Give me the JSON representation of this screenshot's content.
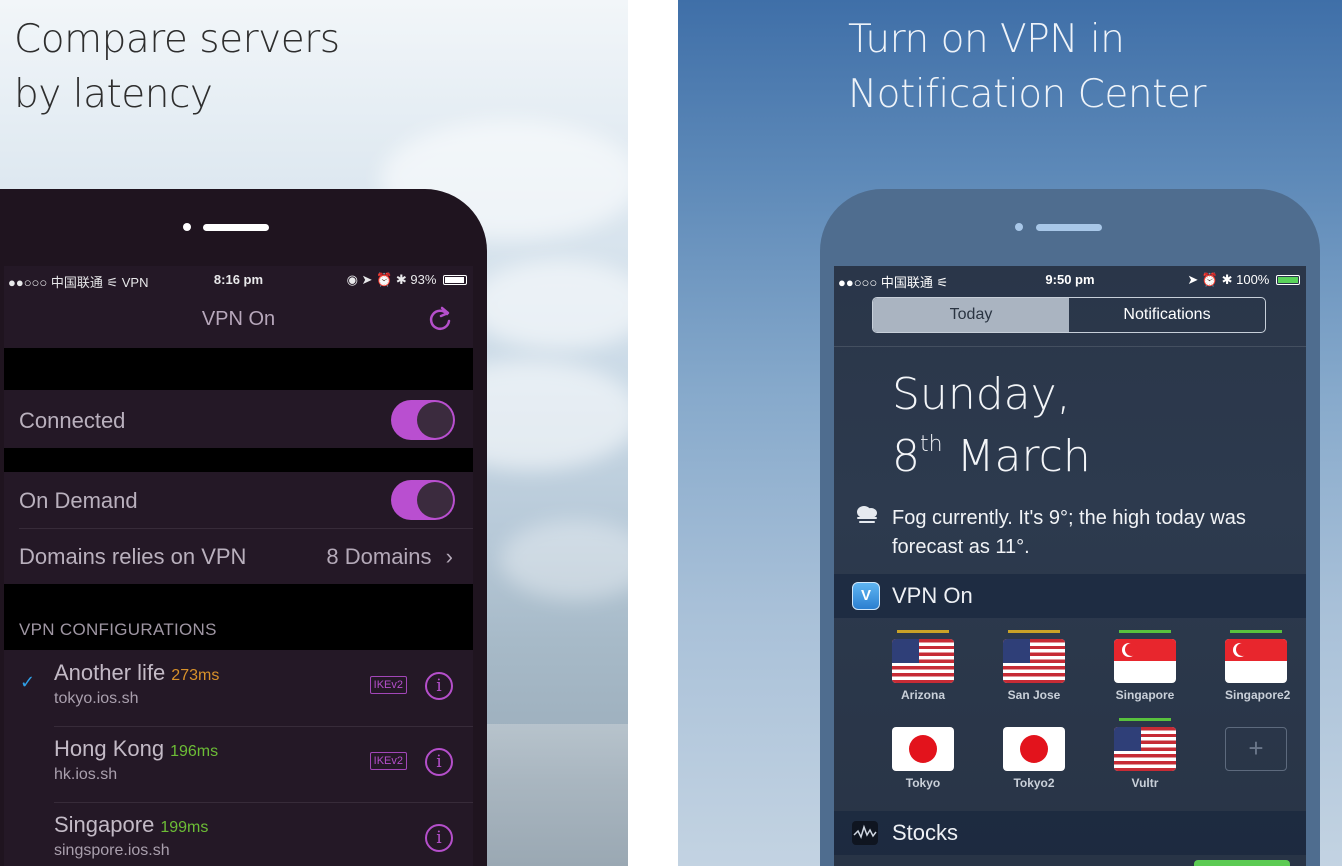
{
  "left_panel": {
    "headline_line1": "Compare servers",
    "headline_line2": "by latency",
    "status_bar": {
      "carrier": "●●○○○ 中国联通 ⚟ VPN",
      "time": "8:16 pm",
      "right": "◉ ➤ ⏰ ✱ 93%",
      "battery_percent": 93
    },
    "nav_title": "VPN On",
    "rows": {
      "connected_label": "Connected",
      "connected_on": true,
      "on_demand_label": "On Demand",
      "on_demand_on": true,
      "domains_label": "Domains relies on VPN",
      "domains_detail": "8 Domains"
    },
    "section_header": "VPN CONFIGURATIONS",
    "configs": [
      {
        "name": "Another life",
        "latency": "273ms",
        "latency_color": "#d8912a",
        "host": "tokyo.ios.sh",
        "protocol": "IKEv2",
        "selected": true
      },
      {
        "name": "Hong Kong",
        "latency": "196ms",
        "latency_color": "#6cbd36",
        "host": "hk.ios.sh",
        "protocol": "IKEv2",
        "selected": false
      },
      {
        "name": "Singapore",
        "latency": "199ms",
        "latency_color": "#6cbd36",
        "host": "singspore.ios.sh",
        "protocol": "",
        "selected": false
      }
    ],
    "chevron": "›",
    "checkmark": "✓",
    "info_glyph": "i"
  },
  "right_panel": {
    "headline_line1": "Turn on VPN in",
    "headline_line2": "Notification Center",
    "status_bar": {
      "carrier": "●●○○○ 中国联通 ⚟",
      "time": "9:50 pm",
      "right": "➤ ⏰ ✱ 100%",
      "battery_percent": 100
    },
    "tabs": {
      "today": "Today",
      "notifications": "Notifications"
    },
    "date_line1": "Sunday,",
    "date_day": "8",
    "date_suffix": "th",
    "date_month": "March",
    "weather": "Fog currently. It's 9°; the high today was forecast as 11°.",
    "widget_title": "VPN On",
    "widget_icon_letter": "V",
    "servers": [
      {
        "label": "Arizona",
        "flag": "us",
        "bar_color": "#c9a227"
      },
      {
        "label": "San Jose",
        "flag": "us",
        "bar_color": "#c9a227"
      },
      {
        "label": "Singapore",
        "flag": "sg",
        "bar_color": "#58c23d"
      },
      {
        "label": "Singapore2",
        "flag": "sg",
        "bar_color": "#58c23d"
      },
      {
        "label": "Tokyo",
        "flag": "jp",
        "bar_color": ""
      },
      {
        "label": "Tokyo2",
        "flag": "jp",
        "bar_color": ""
      },
      {
        "label": "Vultr",
        "flag": "us",
        "bar_color": "#58c23d"
      }
    ],
    "add_glyph": "+",
    "stocks_title": "Stocks"
  }
}
